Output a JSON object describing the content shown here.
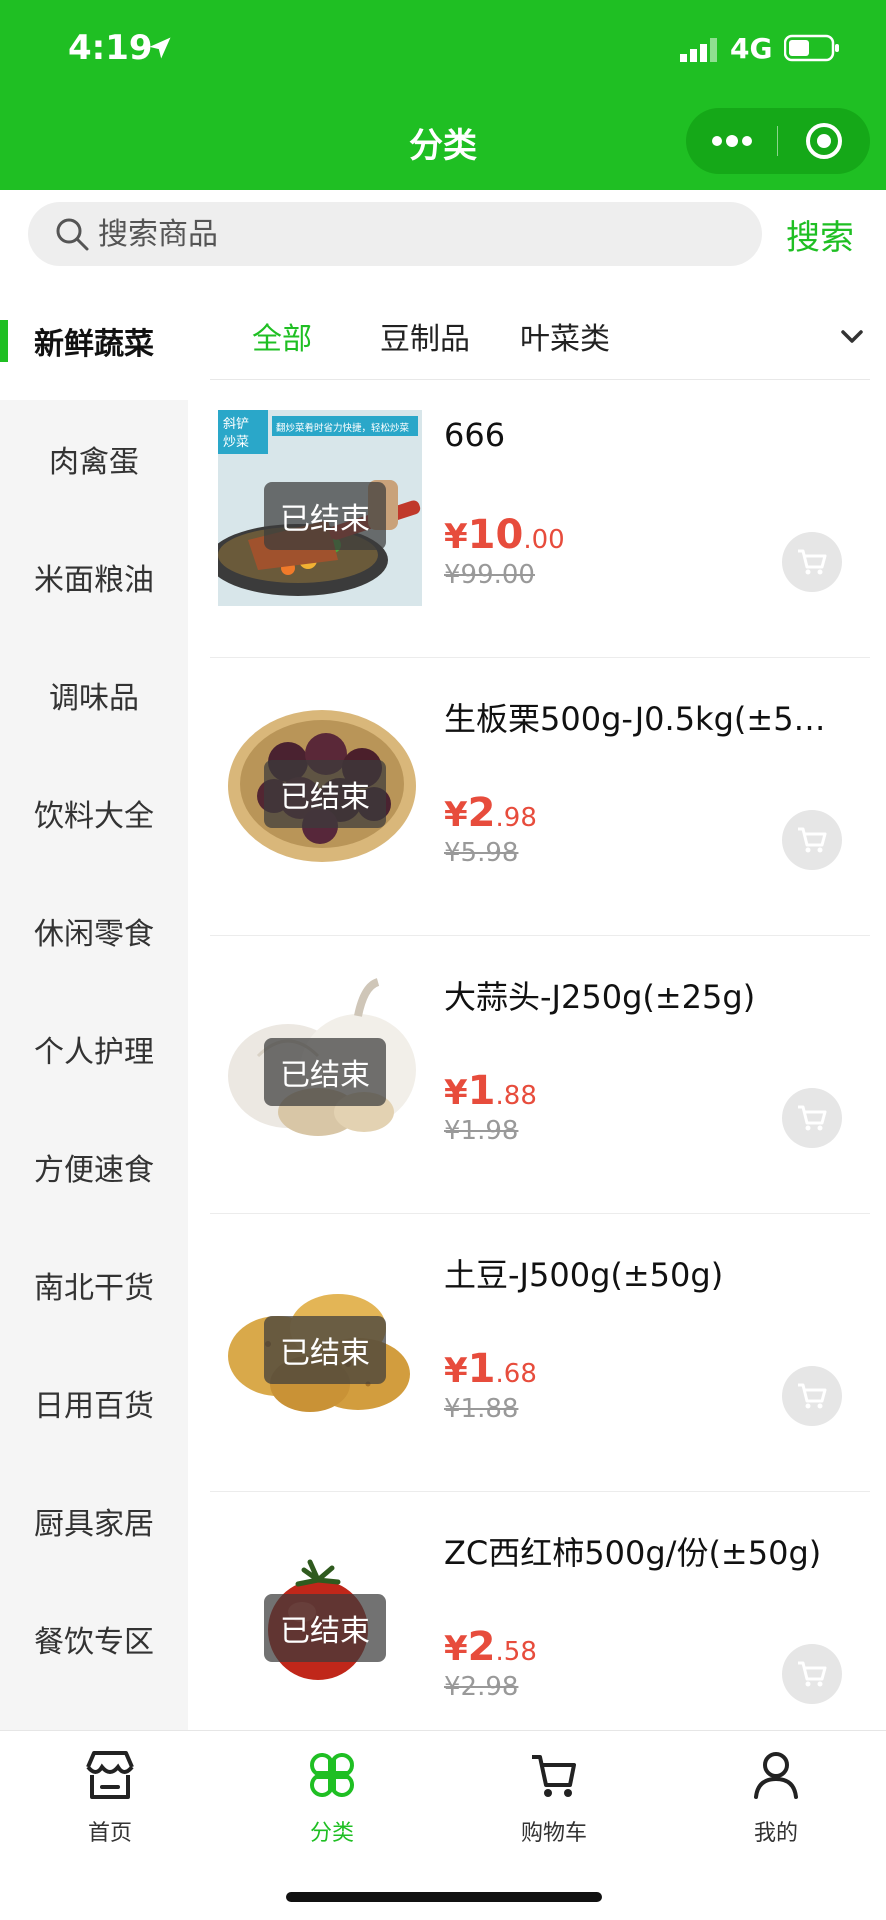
{
  "status_bar": {
    "time": "4:19",
    "network": "4G"
  },
  "nav": {
    "title": "分类"
  },
  "search": {
    "placeholder": "搜索商品",
    "button": "搜索"
  },
  "sidebar": {
    "items": [
      {
        "label": "新鲜蔬菜",
        "active": true
      },
      {
        "label": "肉禽蛋"
      },
      {
        "label": "米面粮油"
      },
      {
        "label": "调味品"
      },
      {
        "label": "饮料大全"
      },
      {
        "label": "休闲零食"
      },
      {
        "label": "个人护理"
      },
      {
        "label": "方便速食"
      },
      {
        "label": "南北干货"
      },
      {
        "label": "日用百货"
      },
      {
        "label": "厨具家居"
      },
      {
        "label": "餐饮专区"
      }
    ]
  },
  "tabs": [
    {
      "label": "全部",
      "active": true
    },
    {
      "label": "豆制品"
    },
    {
      "label": "叶菜类"
    }
  ],
  "ended_label": "已结束",
  "products": [
    {
      "name": "666",
      "currency": "¥",
      "price_int": "10",
      "price_dec": ".00",
      "original": "¥99.00",
      "image": "spatula-product-image",
      "image_text": "斜铲炒菜",
      "banner_text": "翻炒菜肴时省力快捷，轻松炒菜"
    },
    {
      "name": "生板栗500g-J0.5kg(±5…",
      "currency": "¥",
      "price_int": "2",
      "price_dec": ".98",
      "original": "¥5.98",
      "image": "chestnut-image"
    },
    {
      "name": "大蒜头-J250g(±25g)",
      "currency": "¥",
      "price_int": "1",
      "price_dec": ".88",
      "original": "¥1.98",
      "image": "garlic-image"
    },
    {
      "name": "土豆-J500g(±50g)",
      "currency": "¥",
      "price_int": "1",
      "price_dec": ".68",
      "original": "¥1.88",
      "image": "potato-image"
    },
    {
      "name": "ZC西红柿500g/份(±50g)",
      "currency": "¥",
      "price_int": "2",
      "price_dec": ".58",
      "original": "¥2.98",
      "image": "tomato-image"
    }
  ],
  "tabbar": [
    {
      "label": "首页",
      "icon": "store-icon"
    },
    {
      "label": "分类",
      "icon": "category-icon",
      "active": true
    },
    {
      "label": "购物车",
      "icon": "cart-icon"
    },
    {
      "label": "我的",
      "icon": "user-icon"
    }
  ],
  "colors": {
    "brand_green": "#1fbf23",
    "price_red": "#e74c3c"
  }
}
